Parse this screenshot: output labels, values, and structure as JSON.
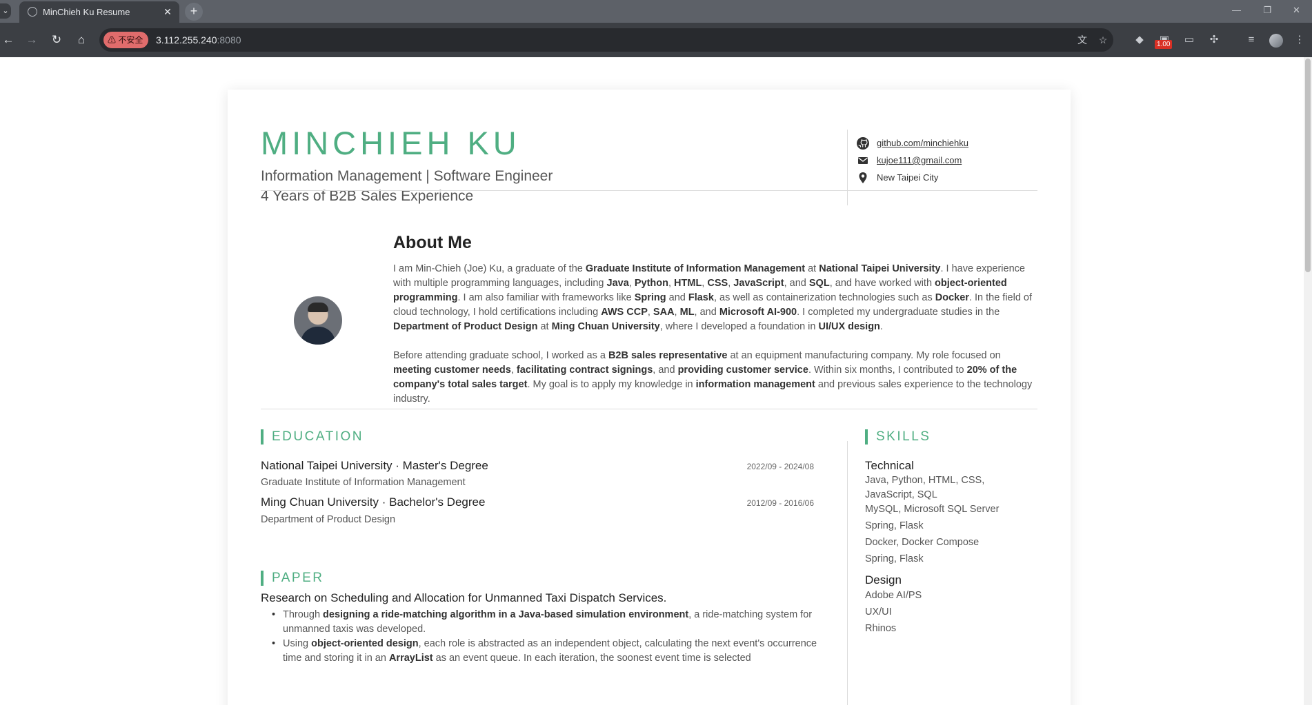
{
  "browser": {
    "tab_title": "MinChieh Ku Resume",
    "insecure_label": "不安全",
    "url_host": "3.112.255.240",
    "url_port": ":8080",
    "extension_badge": "1.00"
  },
  "header": {
    "name": "MINCHIEH KU",
    "subtitle_line1": "Information Management | Software Engineer",
    "subtitle_line2": "4 Years of B2B Sales Experience",
    "contact": {
      "github": "github.com/minchiehku",
      "email": "kujoe111@gmail.com",
      "location": "New Taipei City"
    }
  },
  "about": {
    "title": "About Me",
    "p1": [
      {
        "t": "I am Min-Chieh (Joe) Ku, a graduate of the "
      },
      {
        "t": "Graduate Institute of Information Management",
        "b": true
      },
      {
        "t": " at "
      },
      {
        "t": "National Taipei University",
        "b": true
      },
      {
        "t": ". I have experience with multiple programming languages, including "
      },
      {
        "t": "Java",
        "b": true
      },
      {
        "t": ", "
      },
      {
        "t": "Python",
        "b": true
      },
      {
        "t": ", "
      },
      {
        "t": "HTML",
        "b": true
      },
      {
        "t": ", "
      },
      {
        "t": "CSS",
        "b": true
      },
      {
        "t": ", "
      },
      {
        "t": "JavaScript",
        "b": true
      },
      {
        "t": ", and "
      },
      {
        "t": "SQL",
        "b": true
      },
      {
        "t": ", and have worked with "
      },
      {
        "t": "object-oriented programming",
        "b": true
      },
      {
        "t": ". I am also familiar with frameworks like "
      },
      {
        "t": "Spring",
        "b": true
      },
      {
        "t": " and "
      },
      {
        "t": "Flask",
        "b": true
      },
      {
        "t": ", as well as containerization technologies such as "
      },
      {
        "t": "Docker",
        "b": true
      },
      {
        "t": ". In the field of cloud technology, I hold certifications including "
      },
      {
        "t": "AWS CCP",
        "b": true
      },
      {
        "t": ", "
      },
      {
        "t": "SAA",
        "b": true
      },
      {
        "t": ", "
      },
      {
        "t": "ML",
        "b": true
      },
      {
        "t": ", and "
      },
      {
        "t": "Microsoft AI-900",
        "b": true
      },
      {
        "t": ". I completed my undergraduate studies in the "
      },
      {
        "t": "Department of Product Design",
        "b": true
      },
      {
        "t": " at "
      },
      {
        "t": "Ming Chuan University",
        "b": true
      },
      {
        "t": ", where I developed a foundation in "
      },
      {
        "t": "UI/UX design",
        "b": true
      },
      {
        "t": "."
      }
    ],
    "p2": [
      {
        "t": "Before attending graduate school, I worked as a "
      },
      {
        "t": "B2B sales representative",
        "b": true
      },
      {
        "t": " at an equipment manufacturing company. My role focused on "
      },
      {
        "t": "meeting customer needs",
        "b": true
      },
      {
        "t": ", "
      },
      {
        "t": "facilitating contract signings",
        "b": true
      },
      {
        "t": ", and "
      },
      {
        "t": "providing customer service",
        "b": true
      },
      {
        "t": ". Within six months, I contributed to "
      },
      {
        "t": "20% of the company's total sales target",
        "b": true
      },
      {
        "t": ". My goal is to apply my knowledge in "
      },
      {
        "t": "information management",
        "b": true
      },
      {
        "t": " and previous sales experience to the technology industry."
      }
    ]
  },
  "education": {
    "heading": "EDUCATION",
    "items": [
      {
        "title": "National Taipei University · Master's Degree",
        "date": "2022/09 - 2024/08",
        "sub": "Graduate Institute of Information Management"
      },
      {
        "title": "Ming Chuan University · Bachelor's Degree",
        "date": "2012/09 - 2016/06",
        "sub": "Department of Product Design"
      }
    ]
  },
  "paper": {
    "heading": "PAPER",
    "title": "Research on Scheduling and Allocation for Unmanned Taxi Dispatch Services.",
    "bullets": [
      [
        {
          "t": "Through "
        },
        {
          "t": "designing a ride-matching algorithm in a Java-based simulation environment",
          "b": true
        },
        {
          "t": ", a ride-matching system for unmanned taxis was developed."
        }
      ],
      [
        {
          "t": "Using "
        },
        {
          "t": "object-oriented design",
          "b": true
        },
        {
          "t": ", each role is abstracted as an independent object, calculating the next event's occurrence time and storing it in an "
        },
        {
          "t": "ArrayList",
          "b": true
        },
        {
          "t": " as an event queue. In each iteration, the soonest event time is selected"
        }
      ]
    ]
  },
  "skills": {
    "heading": "SKILLS",
    "technical_label": "Technical",
    "technical": [
      "Java, Python, HTML, CSS, JavaScript, SQL",
      "MySQL, Microsoft SQL Server",
      "Spring, Flask",
      "Docker, Docker Compose",
      "Spring, Flask"
    ],
    "design_label": "Design",
    "design": [
      "Adobe AI/PS",
      "UX/UI",
      "Rhinos"
    ]
  }
}
